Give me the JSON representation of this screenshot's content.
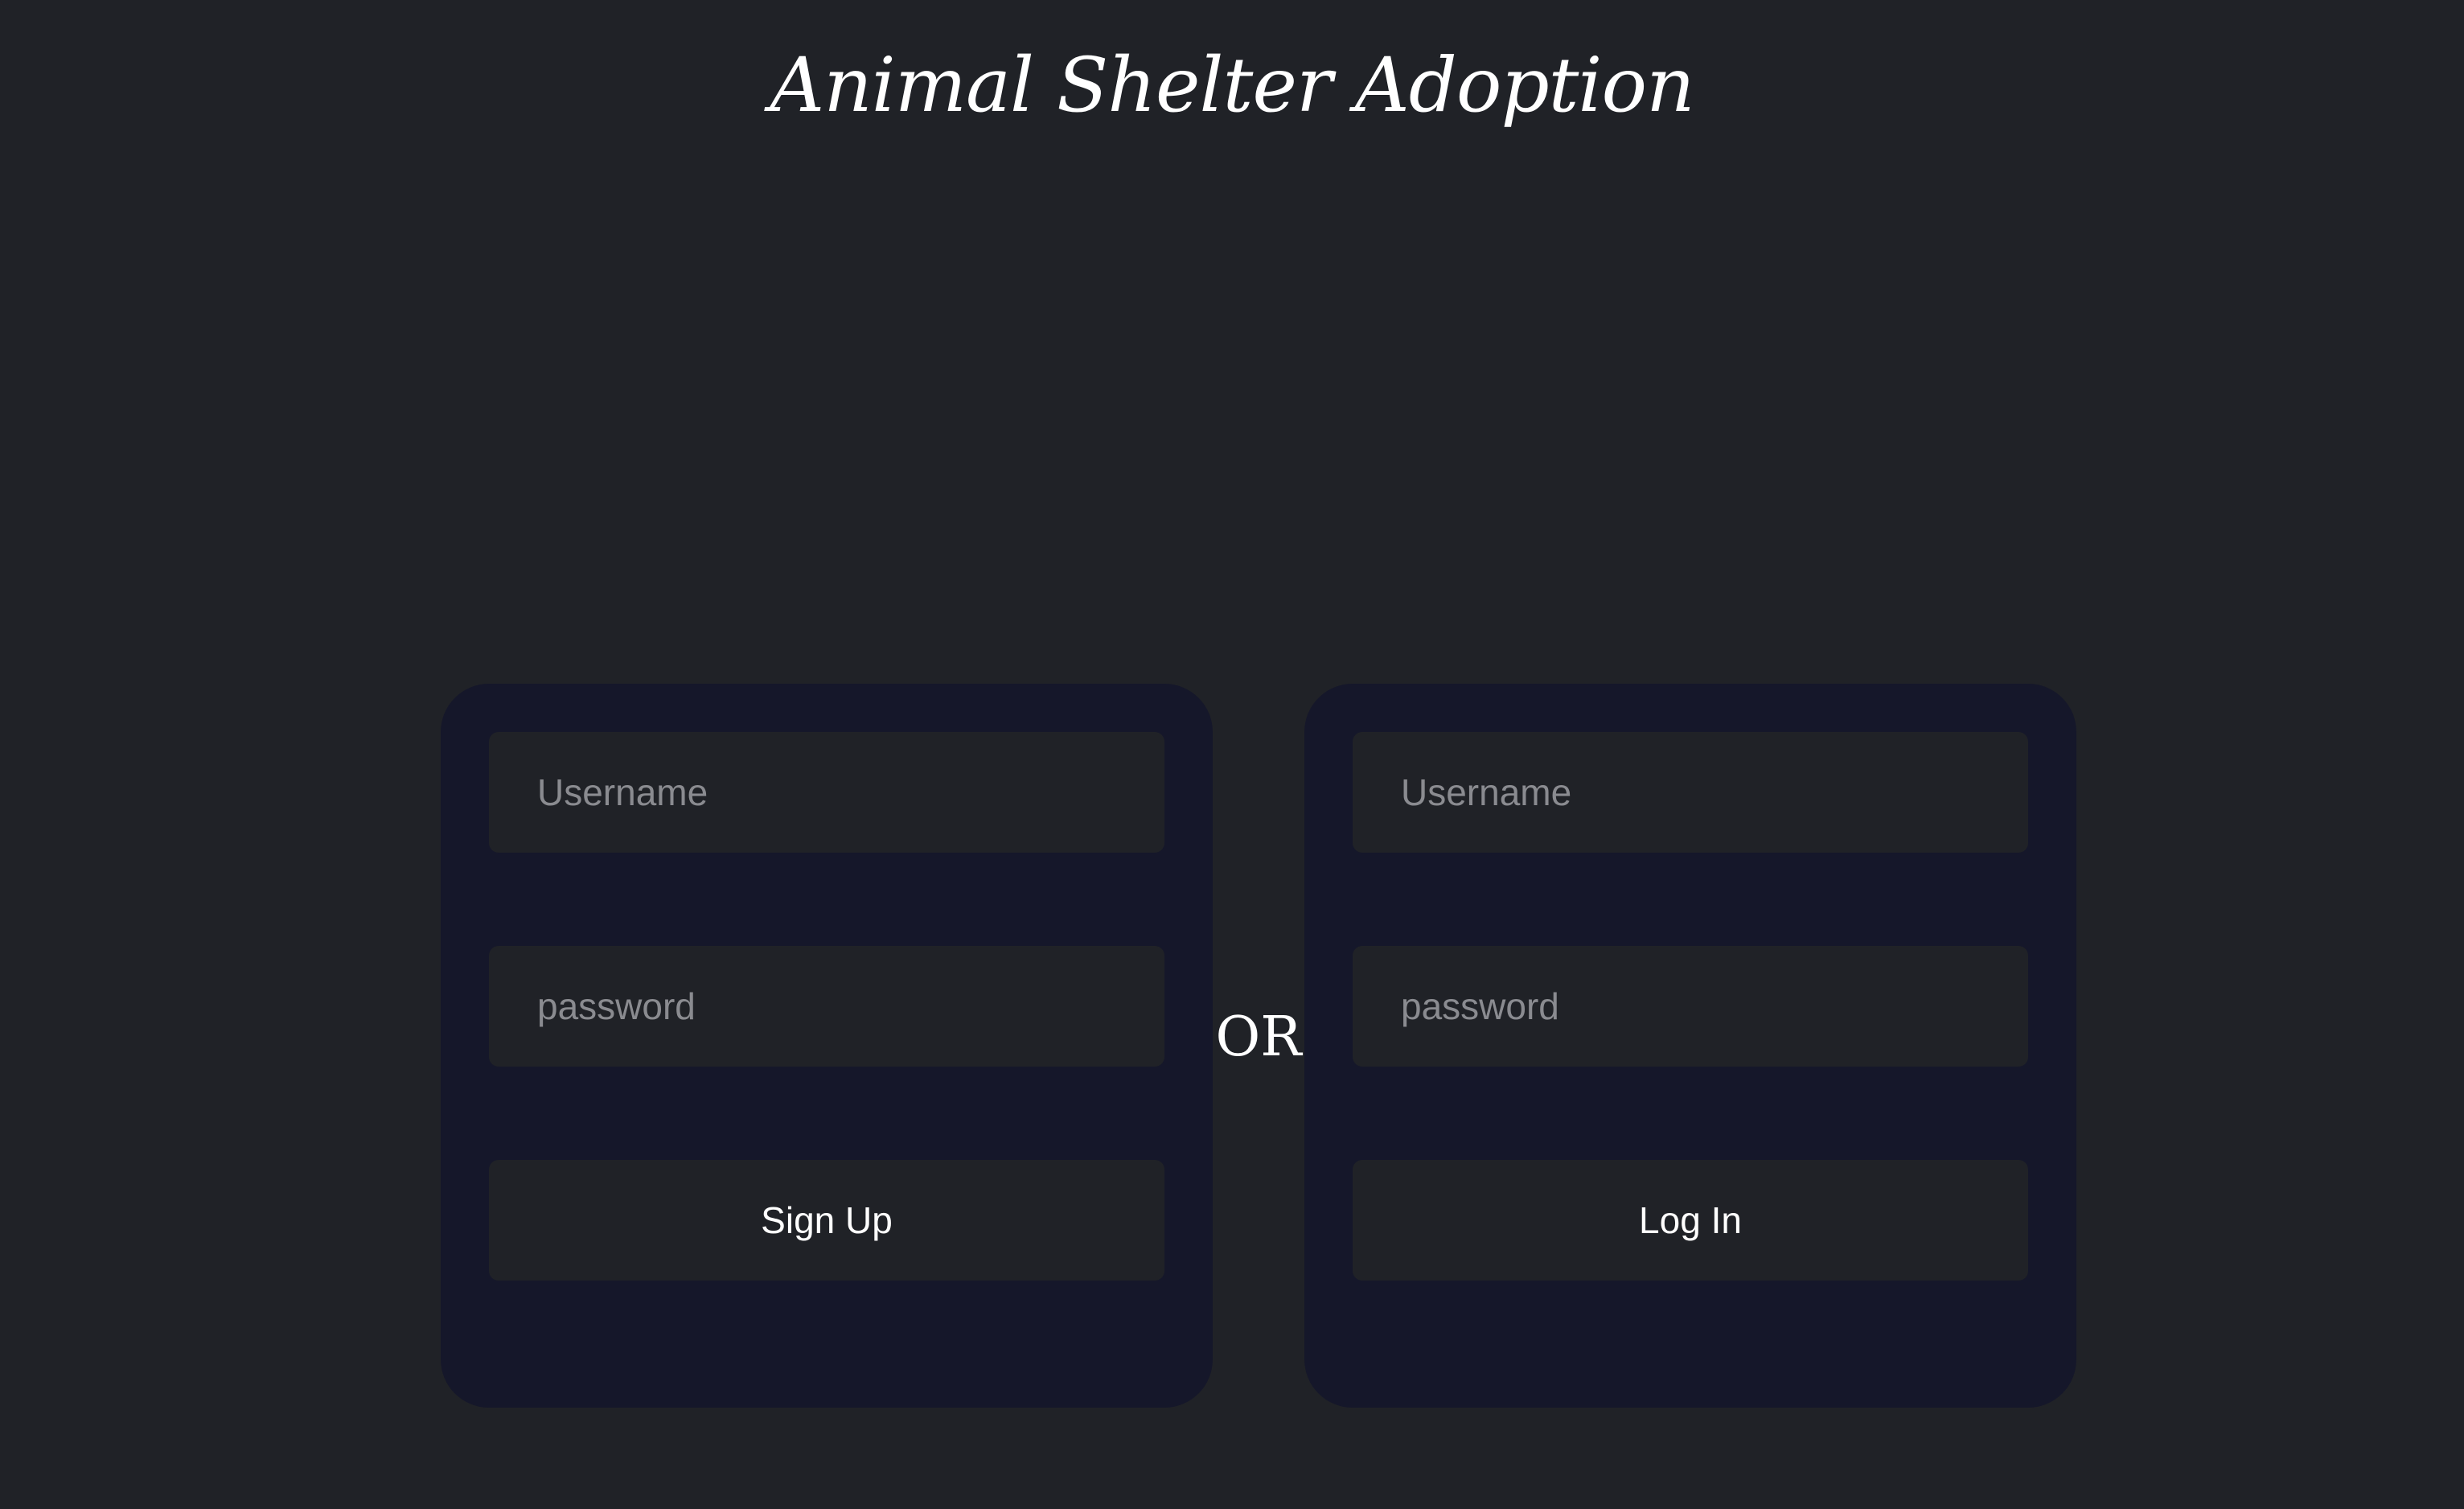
{
  "page": {
    "title": "Animal Shelter Adoption",
    "separator": "OR"
  },
  "signup": {
    "username_placeholder": "Username",
    "password_placeholder": "password",
    "button_label": "Sign Up"
  },
  "login": {
    "username_placeholder": "Username",
    "password_placeholder": "password",
    "button_label": "Log In"
  },
  "colors": {
    "background": "#202227",
    "card": "#15172a",
    "field": "#202227",
    "placeholder": "#8a8b90",
    "text": "#ffffff"
  }
}
